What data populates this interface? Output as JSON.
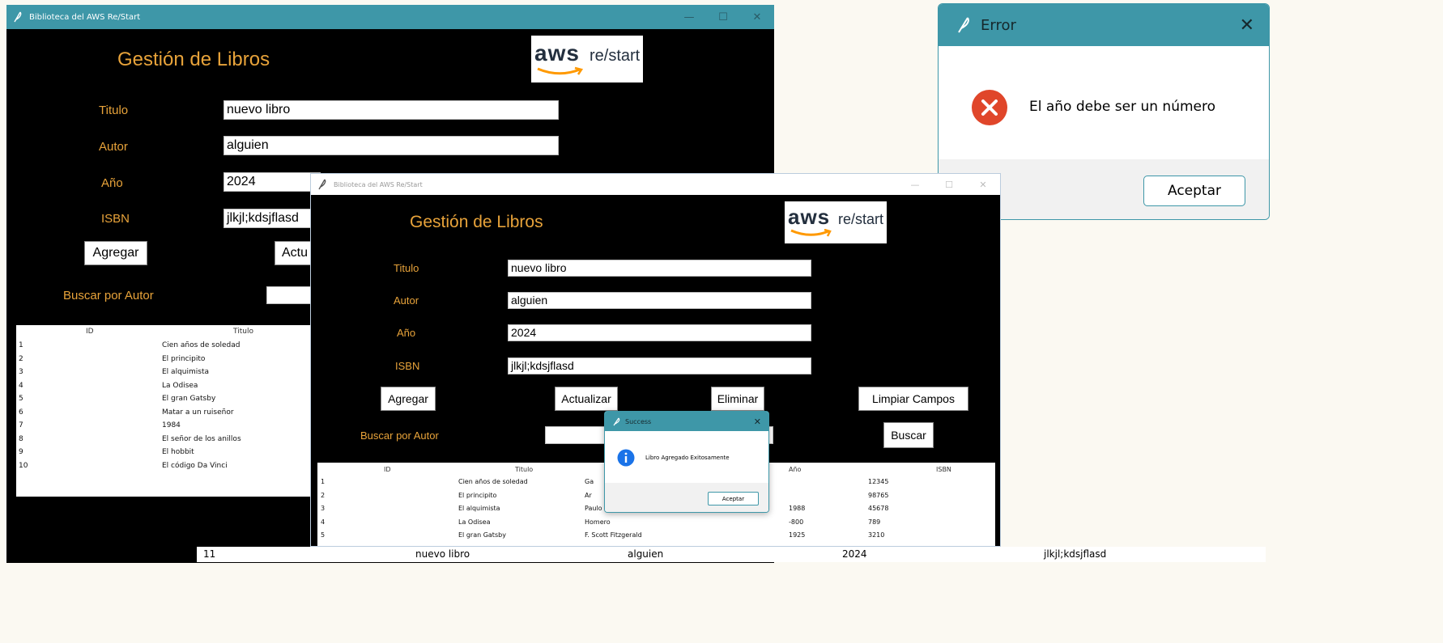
{
  "back_window": {
    "title": "Biblioteca del AWS Re/Start",
    "heading": "Gestión de Libros",
    "logo": {
      "aws": "aws",
      "restart": "re/start"
    },
    "fields": {
      "titulo_label": "Titulo",
      "titulo_value": "nuevo libro",
      "autor_label": "Autor",
      "autor_value": "alguien",
      "anio_label": "Año",
      "anio_value": "2024",
      "isbn_label": "ISBN",
      "isbn_value": "jlkjl;kdsjflasd"
    },
    "buttons": {
      "agregar": "Agregar",
      "actualizar_partial": "Actu"
    },
    "search_label": "Buscar por Autor",
    "table": {
      "headers": [
        "ID",
        "Titulo"
      ],
      "rows": [
        [
          "1",
          "Cien años de soledad"
        ],
        [
          "2",
          "El principito"
        ],
        [
          "3",
          "El alquimista"
        ],
        [
          "4",
          "La Odisea"
        ],
        [
          "5",
          "El gran Gatsby"
        ],
        [
          "6",
          "Matar a un ruiseñor"
        ],
        [
          "7",
          "1984"
        ],
        [
          "8",
          "El señor de los anillos"
        ],
        [
          "9",
          "El hobbit"
        ],
        [
          "10",
          "El código Da Vinci"
        ]
      ]
    }
  },
  "front_window": {
    "title": "Biblioteca del AWS Re/Start",
    "heading": "Gestión de Libros",
    "logo": {
      "aws": "aws",
      "restart": "re/start"
    },
    "fields": {
      "titulo_label": "Titulo",
      "titulo_value": "nuevo libro",
      "autor_label": "Autor",
      "autor_value": "alguien",
      "anio_label": "Año",
      "anio_value": "2024",
      "isbn_label": "ISBN",
      "isbn_value": "jlkjl;kdsjflasd"
    },
    "buttons": {
      "agregar": "Agregar",
      "actualizar": "Actualizar",
      "eliminar": "Eliminar",
      "limpiar": "Limpiar Campos",
      "buscar": "Buscar"
    },
    "search_label": "Buscar por Autor",
    "table": {
      "headers": [
        "ID",
        "Titulo",
        "Año",
        "ISBN"
      ],
      "rows": [
        {
          "id": "1",
          "titulo": "Cien años de soledad",
          "autor": "Ga",
          "anio": "",
          "isbn": "12345"
        },
        {
          "id": "2",
          "titulo": "El principito",
          "autor": "Ar",
          "anio": "",
          "isbn": "98765"
        },
        {
          "id": "3",
          "titulo": "El alquimista",
          "autor": "Paulo Coelho",
          "anio": "1988",
          "isbn": "45678"
        },
        {
          "id": "4",
          "titulo": "La Odisea",
          "autor": "Homero",
          "anio": "-800",
          "isbn": "789"
        },
        {
          "id": "5",
          "titulo": "El gran Gatsby",
          "autor": "F. Scott Fitzgerald",
          "anio": "1925",
          "isbn": "3210"
        }
      ]
    }
  },
  "success_dialog": {
    "title": "Success",
    "message": "Libro Agregado Exitosamente",
    "button": "Aceptar",
    "icon": "info-icon"
  },
  "error_dialog": {
    "title": "Error",
    "message": "El año debe ser un número",
    "button": "Aceptar",
    "icon": "error-icon"
  },
  "bottom_row": {
    "id": "11",
    "titulo": "nuevo libro",
    "autor": "alguien",
    "anio": "2024",
    "isbn": "jlkjl;kdsjflasd"
  },
  "colors": {
    "titlebar": "#3e97a8",
    "accent": "#e8a33a",
    "error": "#e0462a",
    "info": "#1a73e8"
  }
}
